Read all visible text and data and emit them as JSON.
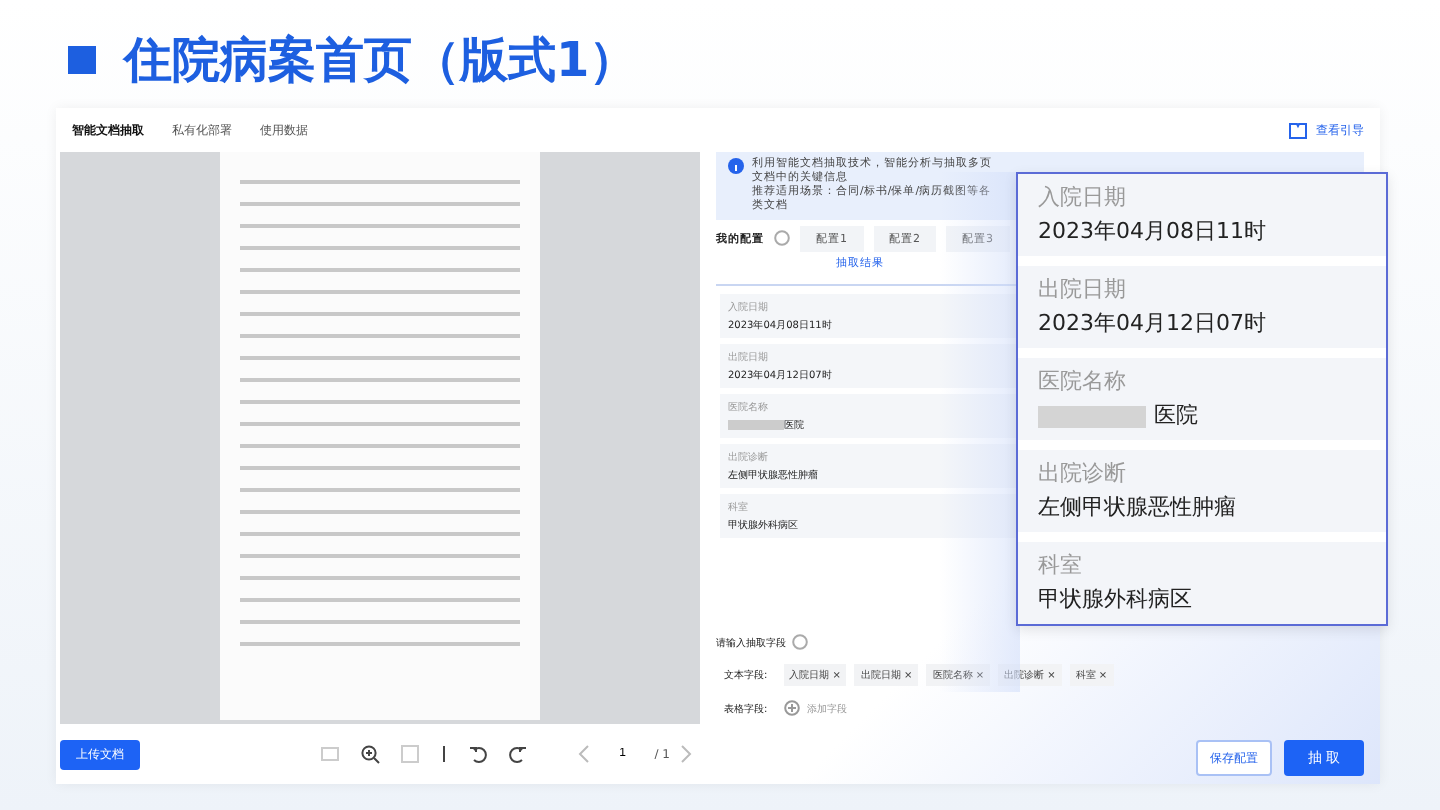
{
  "page_title": "住院病案首页（版式1）",
  "tabs": [
    {
      "label": "智能文档抽取",
      "selected": true
    },
    {
      "label": "私有化部署",
      "selected": false
    },
    {
      "label": "使用数据",
      "selected": false
    }
  ],
  "guide_link": "查看引导",
  "viewer": {
    "upload_button": "上传文档",
    "page_input": "1",
    "page_total": "/ 1"
  },
  "notice": {
    "lines": [
      "利用智能文档抽取技术，智能分析与抽取多页文档中的关键信息",
      "推荐适用场景：合同/标书/保单/病历截图等各类文档"
    ]
  },
  "configs": {
    "label": "我的配置",
    "items": [
      {
        "label": "配置1",
        "selected": false
      },
      {
        "label": "配置2",
        "selected": false
      },
      {
        "label": "配置3",
        "selected": false
      }
    ]
  },
  "results_tab": "抽取结果",
  "results": [
    {
      "label": "入院日期",
      "value": "2023年04月08日11时",
      "redacted": false
    },
    {
      "label": "出院日期",
      "value": "2023年04月12日07时",
      "redacted": false
    },
    {
      "label": "医院名称",
      "value": "医院",
      "redacted": true
    },
    {
      "label": "出院诊断",
      "value": "左侧甲状腺恶性肿瘤",
      "redacted": false
    },
    {
      "label": "科室",
      "value": "甲状腺外科病区",
      "redacted": false
    }
  ],
  "magnified": [
    {
      "label": "入院日期",
      "value": "2023年04月08日11时",
      "redacted": false
    },
    {
      "label": "出院日期",
      "value": "2023年04月12日07时",
      "redacted": false
    },
    {
      "label": "医院名称",
      "value": "医院",
      "redacted": true
    },
    {
      "label": "出院诊断",
      "value": "左侧甲状腺恶性肿瘤",
      "redacted": false
    },
    {
      "label": "科室",
      "value": "甲状腺外科病区",
      "redacted": false
    }
  ],
  "fields": {
    "heading": "请输入抽取字段",
    "text_label": "文本字段:",
    "text_tags": [
      "入院日期",
      "出院日期",
      "医院名称",
      "出院诊断",
      "科室"
    ],
    "tag_remove": "×",
    "table_label": "表格字段:",
    "add_field": "添加字段"
  },
  "buttons": {
    "save": "保存配置",
    "extract": "抽 取"
  }
}
